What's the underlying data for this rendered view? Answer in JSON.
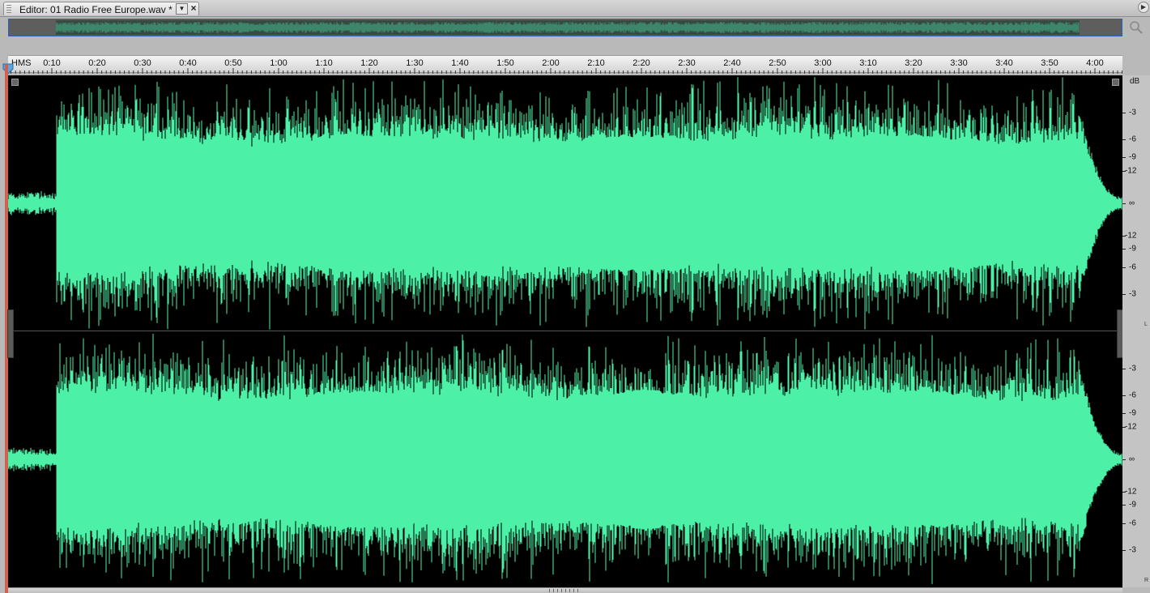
{
  "editor_tab": {
    "title": "Editor: 01 Radio Free Europe.wav *",
    "menu_glyph": "▼",
    "close_glyph": "×"
  },
  "panel_menu_glyph": "▶",
  "ruler": {
    "unit_label": "HMS",
    "labels": [
      "0:10",
      "0:20",
      "0:30",
      "0:40",
      "0:50",
      "1:00",
      "1:10",
      "1:20",
      "1:30",
      "1:40",
      "1:50",
      "2:00",
      "2:10",
      "2:20",
      "2:30",
      "2:40",
      "2:50",
      "3:00",
      "3:10",
      "3:20",
      "3:30",
      "3:40",
      "3:50",
      "4:00"
    ]
  },
  "db_scale": {
    "unit": "dB",
    "channels": [
      {
        "name": "L",
        "labels": [
          "-3",
          "-6",
          "-9",
          "-12",
          "∞",
          "-12",
          "-9",
          "-6",
          "-3"
        ]
      },
      {
        "name": "R",
        "labels": [
          "-3",
          "-6",
          "-9",
          "-12",
          "∞",
          "-12",
          "-9",
          "-6",
          "-3"
        ]
      }
    ]
  },
  "waveform": {
    "color": "#4cf0a6",
    "background": "#000000",
    "centerline_color": "#8a8a8a"
  },
  "icons": {
    "zoom": "magnifier-icon",
    "playhead": "playhead-marker-icon"
  }
}
